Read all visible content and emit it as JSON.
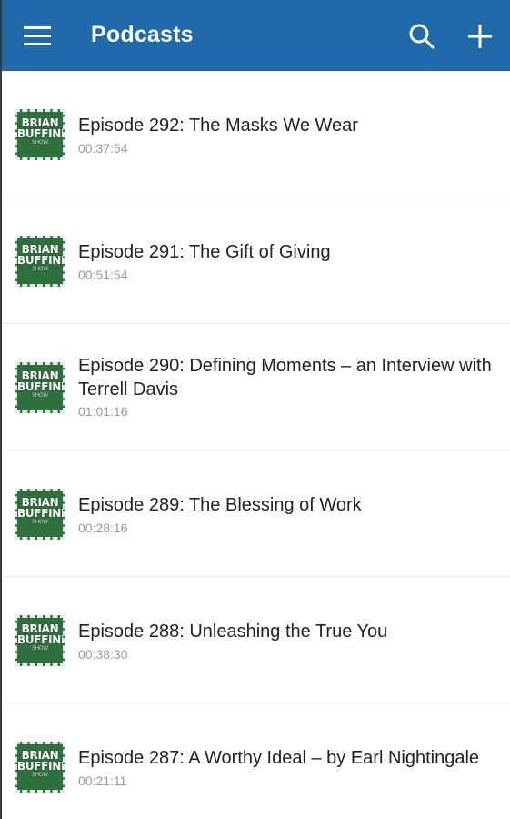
{
  "appbar": {
    "title": "Podcasts",
    "background_color": "#1f6aa8",
    "icons": [
      "menu-icon",
      "search-icon",
      "add-icon"
    ]
  },
  "thumbnail": {
    "logo_text": "BRIAN BUFFINI",
    "logo_subtext": "SHOW"
  },
  "episodes": [
    {
      "title": "Episode 292: The Masks We Wear",
      "duration": "00:37:54"
    },
    {
      "title": "Episode 291: The Gift of Giving",
      "duration": "00:51:54"
    },
    {
      "title": "Episode 290: Defining Moments – an Interview with Terrell Davis",
      "duration": "01:01:16"
    },
    {
      "title": "Episode 289: The Blessing of Work",
      "duration": "00:28:16"
    },
    {
      "title": "Episode 288: Unleashing the True You",
      "duration": "00:38:30"
    },
    {
      "title": "Episode 287: A Worthy Ideal – by Earl Nightingale",
      "duration": "00:21:11"
    }
  ]
}
